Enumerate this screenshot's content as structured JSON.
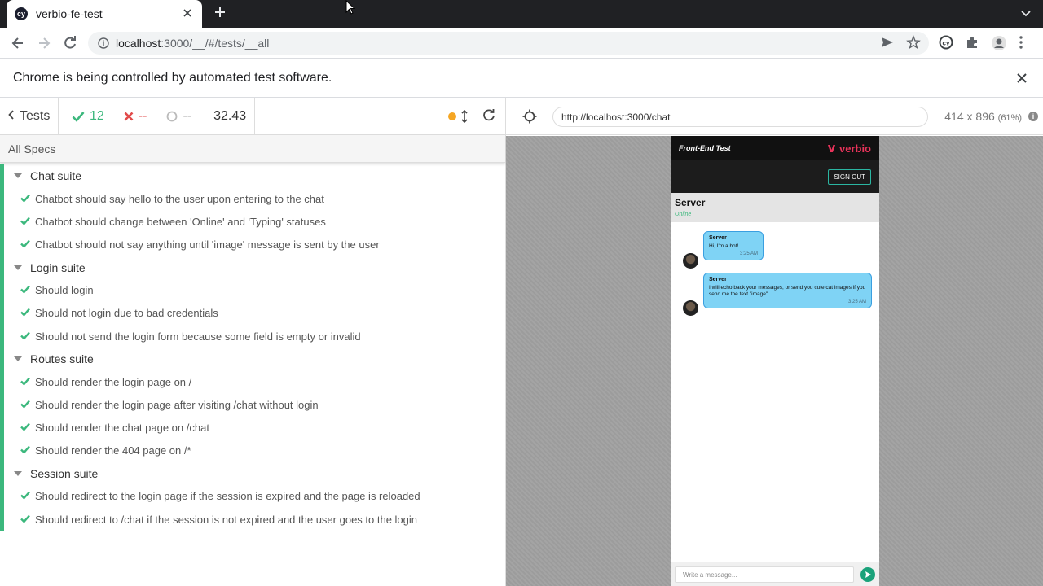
{
  "browser": {
    "tab_title": "verbio-fe-test",
    "tab_icon_text": "cy",
    "url_host": "localhost",
    "url_rest": ":3000/__/#/tests/__all",
    "infobar_text": "Chrome is being controlled by automated test software."
  },
  "reporter": {
    "tests_label": "Tests",
    "passed": "12",
    "failed": "--",
    "pending": "--",
    "duration": "32.43",
    "all_specs": "All Specs",
    "suites": [
      {
        "title": "Chat suite",
        "tests": [
          "Chatbot should say hello to the user upon entering to the chat",
          "Chatbot should change between 'Online' and 'Typing' statuses",
          "Chatbot should not say anything until 'image' message is sent by the user"
        ]
      },
      {
        "title": "Login suite",
        "tests": [
          "Should login",
          "Should not login due to bad credentials",
          "Should not send the login form because some field is empty or invalid"
        ]
      },
      {
        "title": "Routes suite",
        "tests": [
          "Should render the login page on /",
          "Should render the login page after visiting /chat without login",
          "Should render the chat page on /chat",
          "Should render the 404 page on /*"
        ]
      },
      {
        "title": "Session suite",
        "tests": [
          "Should redirect to the login page if the session is expired and the page is reloaded",
          "Should redirect to /chat if the session is not expired and the user goes to the login"
        ]
      }
    ]
  },
  "aut": {
    "url": "http://localhost:3000/chat",
    "viewport": "414 x 896",
    "scale": "(61%)",
    "app": {
      "title": "Front-End Test",
      "brand": "verbio",
      "signout_label": "SIGN OUT",
      "contact_name": "Server",
      "contact_status": "Online",
      "messages": [
        {
          "author": "Server",
          "text": "Hi, I'm a bot!",
          "time": "3:25 AM"
        },
        {
          "author": "Server",
          "text": "I will echo back your messages, or send you cute cat images if you send me the text \"image\".",
          "time": "3:25 AM"
        }
      ],
      "composer_placeholder": "Write a message..."
    }
  },
  "colors": {
    "pass": "#3cb87d",
    "fail": "#e14b4b",
    "running": "#f5a623",
    "bubble": "#7fd3f5",
    "brand": "#e8335a"
  }
}
